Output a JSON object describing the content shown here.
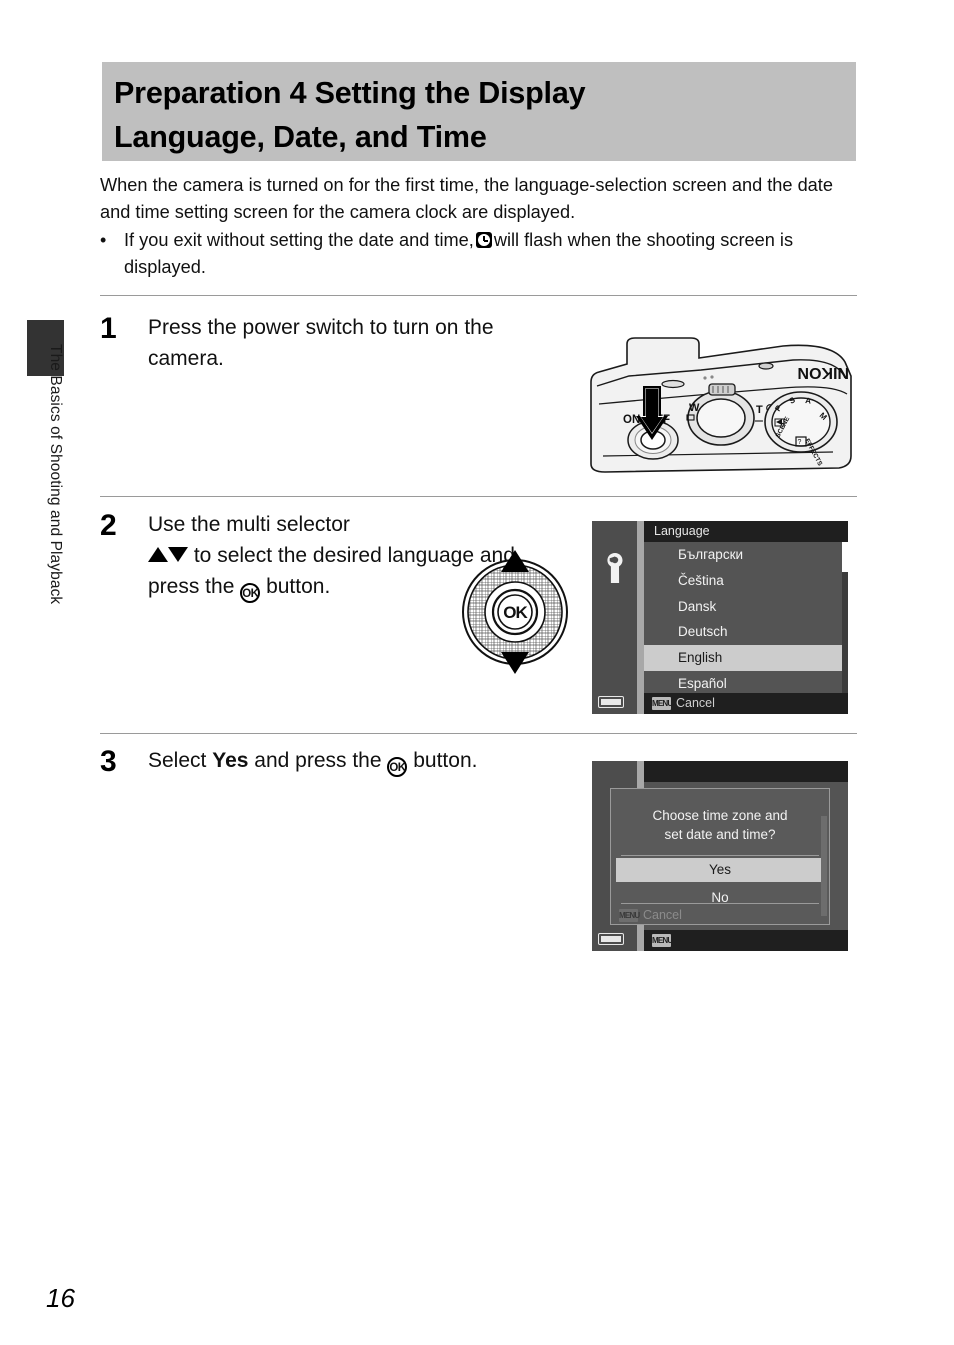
{
  "page": {
    "number": "16",
    "chapter_label": "The Basics of Shooting and Playback"
  },
  "heading": {
    "line1": "Preparation 4 Setting the Display",
    "line2": "Language, Date, and Time"
  },
  "intro": {
    "paragraph": "When the camera is turned on for the first time, the language-selection screen and the date and time setting screen for the camera clock are displayed.",
    "bullet_marker": "•",
    "bullet_before": "If you exit without setting the date and time,",
    "bullet_icon": "clock-icon",
    "bullet_after": "will flash when the shooting screen is displayed."
  },
  "steps": [
    {
      "number": "1",
      "text": "Press the power switch to turn on the camera."
    },
    {
      "number": "2",
      "text_before": "Use the multi selector",
      "text_mid": "to select the desired language and press the",
      "text_after": "button."
    },
    {
      "number": "3",
      "text_before": "Select",
      "emphasis": "Yes",
      "text_mid": "and press the",
      "text_after": "button."
    }
  ],
  "camera_illustration": {
    "brand": "NIKON",
    "power_label": "ON/OFF",
    "zoom_wide": "W",
    "zoom_tele": "T",
    "mode_dial_labels": [
      "P",
      "S",
      "A",
      "M",
      "SCENE",
      "EFFECTS"
    ]
  },
  "multi_selector": {
    "ok_label": "OK"
  },
  "language_screen": {
    "title": "Language",
    "sidebar_icon": "wrench-icon",
    "battery_icon": "battery-icon",
    "items": [
      {
        "label": "Български",
        "selected": false
      },
      {
        "label": "Čeština",
        "selected": false
      },
      {
        "label": "Dansk",
        "selected": false
      },
      {
        "label": "Deutsch",
        "selected": false
      },
      {
        "label": "English",
        "selected": true
      },
      {
        "label": "Español",
        "selected": false
      }
    ],
    "footer_badge": "MENU",
    "footer_label": "Cancel"
  },
  "dialog_screen": {
    "question_line1": "Choose time zone and",
    "question_line2": "set date and time?",
    "options": [
      {
        "label": "Yes",
        "selected": true
      },
      {
        "label": "No",
        "selected": false
      }
    ],
    "cancel_badge": "MENU",
    "cancel_label": "Cancel",
    "footer_badge": "MENU",
    "battery_icon": "battery-icon"
  },
  "colors": {
    "heading_band": "#bfbfbf",
    "tab": "#333333",
    "lcd_bg": "#2b2b2b",
    "lcd_list_bg": "#545454",
    "lcd_selected": "#cccccc",
    "lcd_sidebar": "#4d4d4d"
  }
}
